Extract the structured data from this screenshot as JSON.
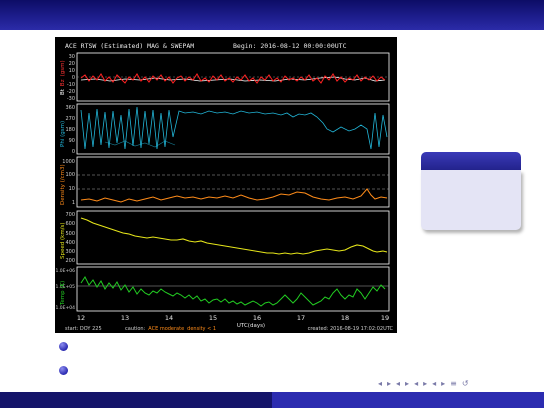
{
  "plot": {
    "title": "ACE RTSW (Estimated) MAG & SWEPAM",
    "begin": "Begin: 2016-08-12 00:00:00UTC",
    "xlabel": "UTC(days)",
    "xticks": [
      "12",
      "13",
      "14",
      "15",
      "16",
      "17",
      "18",
      "19"
    ],
    "footer_start": "start: DOY 225",
    "footer_caution": "caution:",
    "footer_caution_text": "ACE moderate",
    "footer_density": "density < 1",
    "footer_created": "created: 2016-08-19 17:02:02UTC",
    "panels": [
      {
        "id": "bt",
        "label_main": "Bt",
        "label_sub": "Bz",
        "label_unit": "(gsm)",
        "label_color": "#ff3333",
        "ticks": [
          "30",
          "20",
          "10",
          "0",
          "-10",
          "-20",
          "-30"
        ]
      },
      {
        "id": "phi",
        "label_main": "Phi (gsm)",
        "label_color": "#22b6d8",
        "ticks": [
          "360",
          "270",
          "180",
          "90",
          "0"
        ]
      },
      {
        "id": "density",
        "label_main": "Density (/cm3)",
        "label_color": "#ff8c1a",
        "ticks": [
          "1000",
          "100",
          "10",
          "1"
        ]
      },
      {
        "id": "speed",
        "label_main": "Speed (km/s)",
        "label_color": "#e6e61a",
        "ticks": [
          "700",
          "600",
          "500",
          "400",
          "300",
          "200"
        ]
      },
      {
        "id": "temp",
        "label_main": "Temp (K)",
        "label_color": "#22cc22",
        "ticks": [
          "1.0E+06",
          "1.0E+05",
          "1.0E+04"
        ]
      }
    ]
  },
  "nav": {
    "symbols": [
      "◂",
      "▸",
      "◂",
      "▸",
      "◂",
      "▸",
      "◂",
      "▸",
      "≡",
      "↺"
    ]
  }
}
